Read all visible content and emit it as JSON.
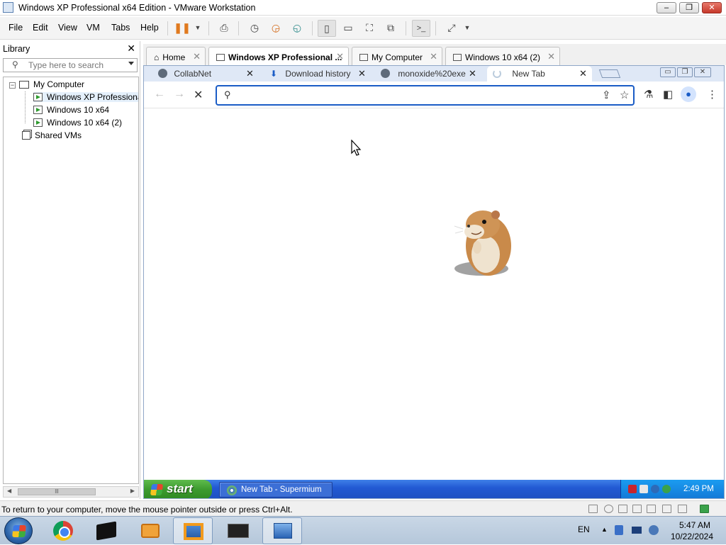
{
  "window": {
    "title": "Windows XP Professional x64 Edition - VMware Workstation",
    "minimize": "–",
    "maximize": "❐",
    "close": "✕"
  },
  "menubar": {
    "items": [
      "File",
      "Edit",
      "View",
      "VM",
      "Tabs",
      "Help"
    ]
  },
  "library": {
    "title": "Library",
    "close": "✕",
    "search_placeholder": "Type here to search",
    "tree": {
      "root": "My Computer",
      "vms": [
        "Windows XP Professiona",
        "Windows 10 x64",
        "Windows 10 x64 (2)"
      ],
      "shared": "Shared VMs"
    },
    "scroll_grip": "lll"
  },
  "vm_tabs": [
    {
      "label": "Home",
      "active": false
    },
    {
      "label": "Windows XP Professional ...",
      "active": true
    },
    {
      "label": "My Computer",
      "active": false
    },
    {
      "label": "Windows 10 x64 (2)",
      "active": false
    }
  ],
  "browser": {
    "tabs": [
      {
        "label": "CollabNet"
      },
      {
        "label": "Download history"
      },
      {
        "label": "monoxide%20exe"
      },
      {
        "label": "New Tab",
        "active": true
      }
    ],
    "omnibox_value": "",
    "accent_color": "#1a5cc6"
  },
  "xp_taskbar": {
    "start_label": "start",
    "task_label": "New Tab - Supermium",
    "clock": "2:49 PM"
  },
  "statusbar": {
    "message": "To return to your computer, move the mouse pointer outside or press Ctrl+Alt."
  },
  "host_taskbar": {
    "language": "EN",
    "time": "5:47 AM",
    "date": "10/22/2024"
  }
}
